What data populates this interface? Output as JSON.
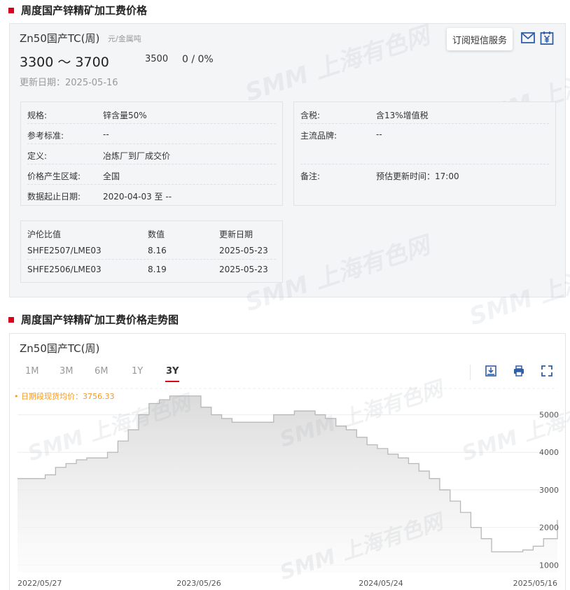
{
  "sections": {
    "price_title": "周度国产锌精矿加工费价格",
    "trend_title": "周度国产锌精矿加工费价格走势图"
  },
  "watermark": "SMM 上海有色网",
  "product": {
    "name": "Zn50国产TC(周)",
    "unit": "元/金属吨",
    "price_range": "3300 ～ 3700",
    "avg": "3500",
    "change": "0 / 0%",
    "update_date": "更新日期：2025-05-16"
  },
  "actions": {
    "subscribe_label": "订阅短信服务",
    "mail_icon": "mail-icon",
    "yuan_icon": "yuan-calendar-icon"
  },
  "specs_left": [
    {
      "key": "规格:",
      "value": "锌含量50%"
    },
    {
      "key": "参考标准:",
      "value": "--"
    },
    {
      "key": "定义:",
      "value": "冶炼厂到厂成交价"
    },
    {
      "key": "价格产生区域:",
      "value": "全国"
    },
    {
      "key": "数据起止日期:",
      "value": "2020-04-03 至 --"
    }
  ],
  "specs_right": [
    {
      "key": "含税:",
      "value": "含13%增值税"
    },
    {
      "key": "主流品牌:",
      "value": "--"
    },
    {
      "key": "备注:",
      "value": "预估更新时间：17:00"
    }
  ],
  "ratio_table": {
    "headers": [
      "沪伦比值",
      "数值",
      "更新日期"
    ],
    "rows": [
      [
        "SHFE2507/LME03",
        "8.16",
        "2025-05-23"
      ],
      [
        "SHFE2506/LME03",
        "8.19",
        "2025-05-23"
      ]
    ]
  },
  "chart": {
    "title": "Zn50国产TC(周)",
    "ranges": [
      "1M",
      "3M",
      "6M",
      "1Y",
      "3Y"
    ],
    "active_range": "3Y",
    "avg_label": "• 日期段现货均价：3756.33",
    "tools": [
      "download-icon",
      "print-icon",
      "fullscreen-icon"
    ]
  },
  "chart_data": {
    "type": "area",
    "y_ticks": [
      "1000",
      "2000",
      "3000",
      "4000",
      "5000"
    ],
    "x_ticks": [
      "2022/05/27",
      "2023/05/26",
      "2024/05/24",
      "2025/05/16"
    ],
    "ylim": [
      800,
      5700
    ],
    "grid": true,
    "colors": {
      "line": "#b8b8b8",
      "fill_top": "#d9d9d9",
      "fill_bottom": "#fbfbfb"
    },
    "x": [
      0,
      4,
      8,
      11,
      14,
      17,
      20,
      23,
      26,
      29,
      32,
      35,
      38,
      41,
      44,
      47,
      50,
      53,
      56,
      59,
      62,
      65,
      68,
      71,
      74,
      77,
      80,
      83,
      86,
      89,
      92,
      95,
      98,
      101,
      104,
      107,
      110,
      113,
      116,
      119,
      122,
      125,
      128,
      131,
      134,
      137,
      140,
      143,
      146,
      149,
      152,
      156
    ],
    "values": [
      3300,
      3300,
      3400,
      3600,
      3700,
      3800,
      3850,
      3850,
      4000,
      4300,
      4600,
      5000,
      5300,
      5400,
      5500,
      5500,
      5500,
      5200,
      5000,
      4900,
      4800,
      4800,
      4800,
      4800,
      5000,
      5000,
      5100,
      5100,
      5000,
      4900,
      4700,
      4600,
      4400,
      4200,
      4100,
      3950,
      3850,
      3700,
      3500,
      3300,
      3000,
      2700,
      2400,
      2000,
      1700,
      1350,
      1350,
      1350,
      1400,
      1500,
      1700,
      2200
    ]
  }
}
